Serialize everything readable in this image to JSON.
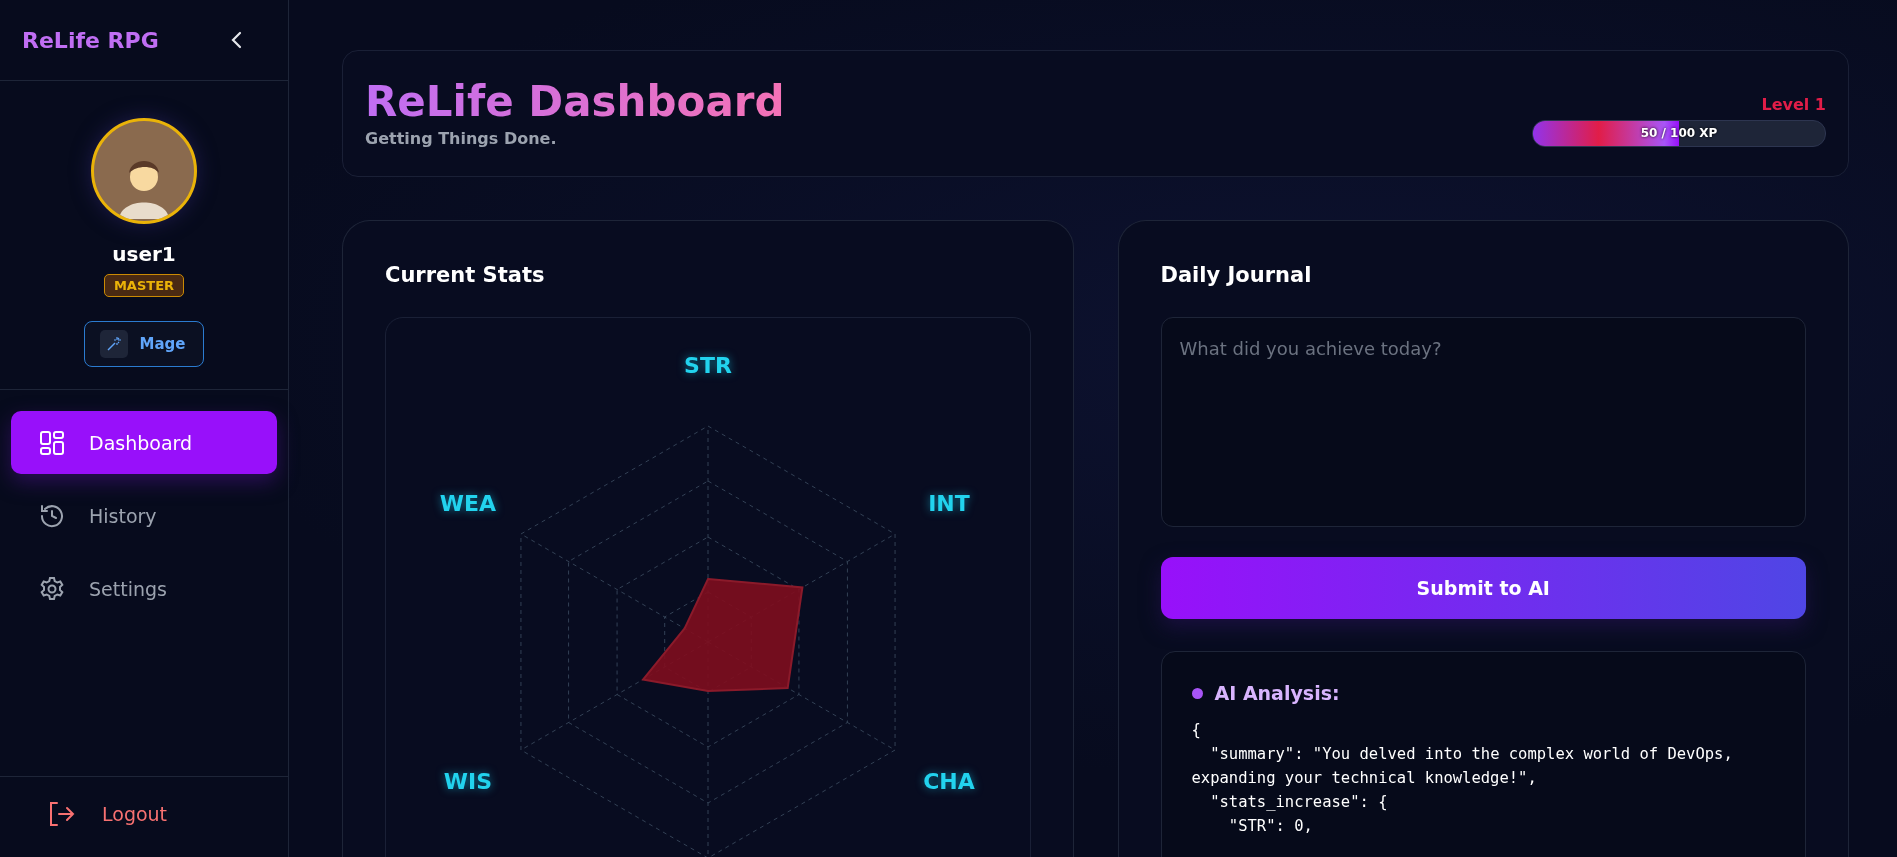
{
  "sidebar": {
    "brand": "ReLife RPG",
    "user": {
      "name": "user1",
      "rank": "MASTER",
      "class": "Mage"
    },
    "nav": [
      {
        "label": "Dashboard",
        "selected": true
      },
      {
        "label": "History",
        "selected": false
      },
      {
        "label": "Settings",
        "selected": false
      }
    ],
    "logout": "Logout"
  },
  "header": {
    "title": "ReLife Dashboard",
    "subtitle": "Getting Things Done.",
    "level_label": "Level 1",
    "xp": {
      "level": 0.5,
      "text": "50 / 100 XP"
    }
  },
  "stats": {
    "title": "Current Stats",
    "axes": [
      "STR",
      "INT",
      "CHA",
      "WIS",
      "WEA"
    ]
  },
  "journal": {
    "title": "Daily Journal",
    "placeholder": "What did you achieve today?",
    "submit": "Submit to AI",
    "analysis": {
      "title": "AI Analysis:",
      "text": "{\n  \"summary\": \"You delved into the complex world of DevOps, expanding your technical knowledge!\",\n  \"stats_increase\": {\n    \"STR\": 0,"
    }
  }
}
